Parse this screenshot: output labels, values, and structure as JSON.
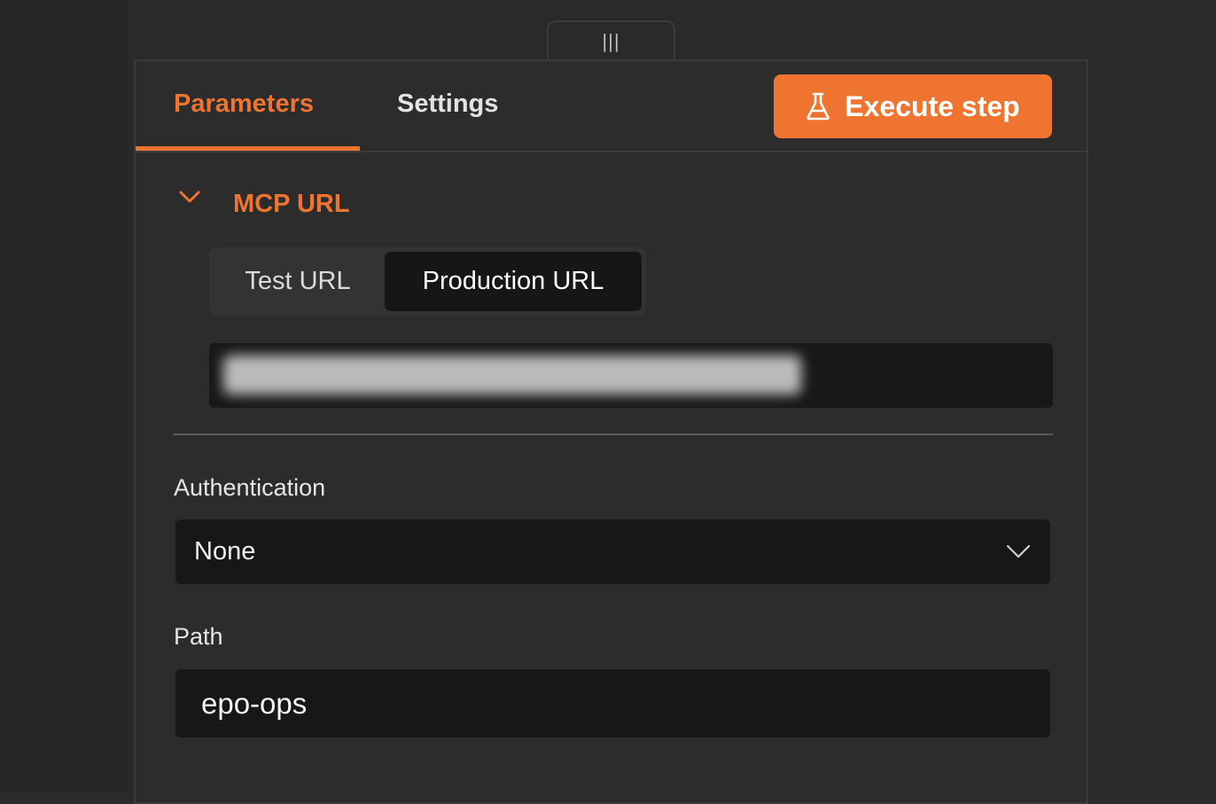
{
  "drag_handle": {
    "glyph": "|||"
  },
  "tabs": {
    "parameters": "Parameters",
    "settings": "Settings",
    "active": "parameters"
  },
  "toolbar": {
    "execute_label": "Execute step",
    "execute_icon": "flask-icon"
  },
  "section": {
    "title": "MCP URL",
    "expanded": true,
    "url_toggle": {
      "options": [
        "Test URL",
        "Production URL"
      ],
      "selected": "Production URL"
    },
    "url_value_blurred": true
  },
  "authentication": {
    "label": "Authentication",
    "value": "None"
  },
  "path": {
    "label": "Path",
    "value": "epo-ops"
  },
  "colors": {
    "accent": "#ee7430",
    "background": "#2c2c2c",
    "field": "#171717",
    "text": "#e6e6e6"
  }
}
